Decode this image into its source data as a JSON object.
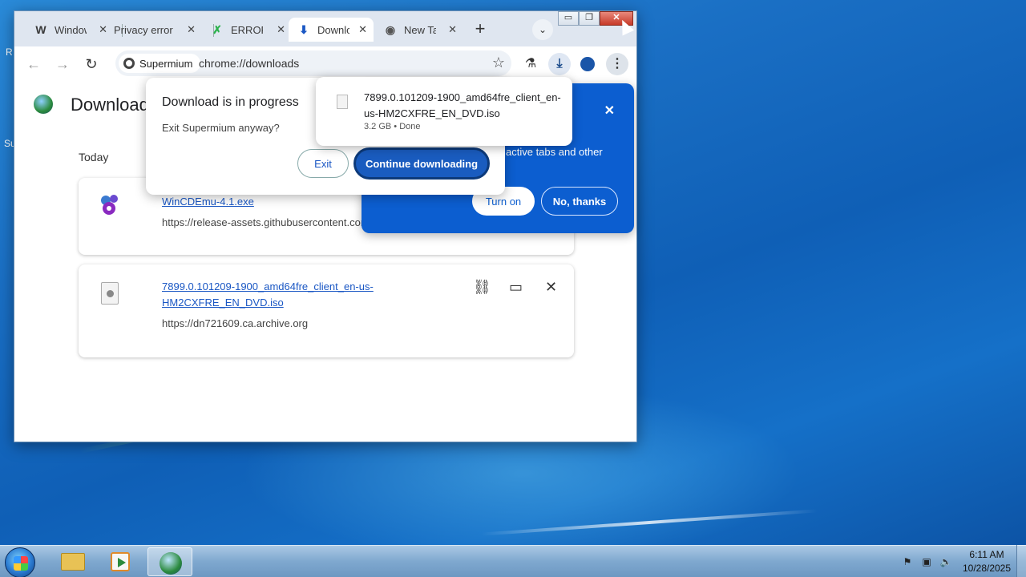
{
  "browser": {
    "tabs": [
      {
        "icon": "wikipedia-icon",
        "label": "Window"
      },
      {
        "icon": "none",
        "label": "Privacy error"
      },
      {
        "icon": "error-icon",
        "label": "ERROR"
      },
      {
        "icon": "download-icon",
        "label": "Downlo"
      },
      {
        "icon": "chrome-icon",
        "label": "New Ta"
      }
    ],
    "site_chip": "Supermium",
    "url": "chrome://downloads"
  },
  "downloads_page": {
    "title": "Downloads",
    "section": "Today",
    "items": [
      {
        "name": "WinCDEmu-4.1.exe",
        "url": "https://release-assets.githubusercontent.com"
      },
      {
        "name": "7899.0.101209-1900_amd64fre_client_en-us-HM2CXFRE_EN_DVD.iso",
        "url": "https://dn721609.ca.archive.org"
      }
    ]
  },
  "exit_dialog": {
    "title": "Download is in progress",
    "message": "Exit Supermium anyway?",
    "exit_label": "Exit",
    "continue_label": "Continue downloading"
  },
  "memory_bubble": {
    "text": "active\nactive tabs and other",
    "turn_on_label": "Turn on",
    "no_thanks_label": "No, thanks"
  },
  "download_bubble": {
    "name": "7899.0.101209-1900_amd64fre_client_en-us-HM2CXFRE_EN_DVD.iso",
    "meta": "3.2 GB • Done"
  },
  "desktop": {
    "edge_labels": [
      "R",
      "Su"
    ]
  },
  "taskbar": {
    "time": "6:11 AM",
    "date": "10/28/2025"
  },
  "colors": {
    "accent": "#1a5cbf",
    "bubble_blue": "#0c5ed0"
  }
}
